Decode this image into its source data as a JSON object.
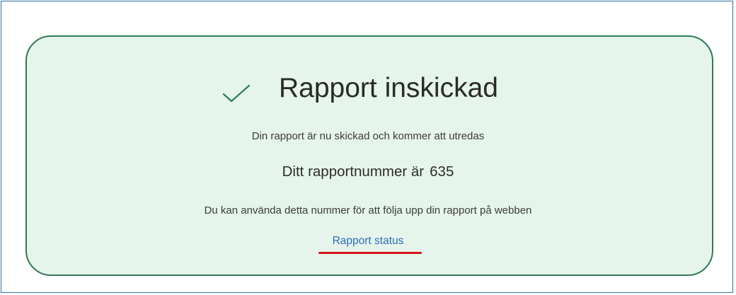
{
  "confirmation": {
    "title": "Rapport inskickad",
    "message": "Din rapport är nu skickad och kommer att utredas",
    "report_number_label": "Ditt rapportnummer är",
    "report_number": "635",
    "info": "Du kan använda detta nummer för att följa upp din rapport på webben",
    "status_link": "Rapport status",
    "icon": "checkmark-icon"
  },
  "colors": {
    "card_background": "#e6f5ec",
    "card_border": "#2f7a55",
    "checkmark": "#2f7a55",
    "link": "#2e6db5",
    "highlight_underline": "#d7141a",
    "frame_border": "#2e6da4"
  }
}
